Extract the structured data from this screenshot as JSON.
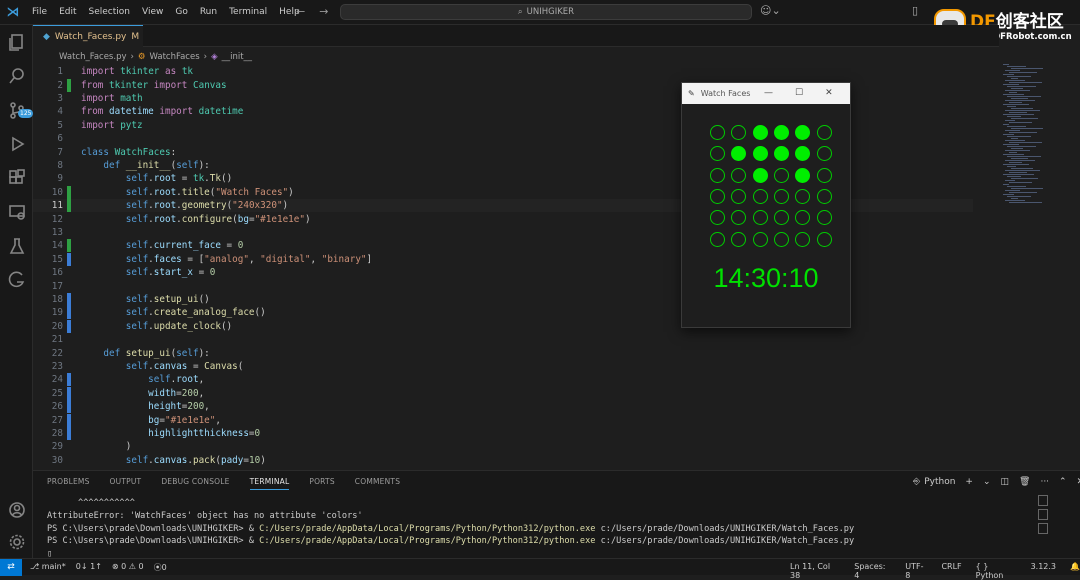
{
  "menu": [
    "File",
    "Edit",
    "Selection",
    "View",
    "Go",
    "Run",
    "Terminal",
    "Help"
  ],
  "search": {
    "text": "UNIHGIKER"
  },
  "watermark": {
    "brand": "DF",
    "name": "创客社区",
    "url": "mc.DFRobot.com.cn"
  },
  "activity": {
    "badge": "125"
  },
  "tab": {
    "filename": "Watch_Faces.py",
    "status": "M"
  },
  "breadcrumb": {
    "file": "Watch_Faces.py",
    "class": "WatchFaces",
    "method": "__init__"
  },
  "code_lines": [
    {
      "n": "1",
      "text": "import tkinter as tk"
    },
    {
      "n": "2",
      "text": "from tkinter import Canvas"
    },
    {
      "n": "3",
      "text": "import math"
    },
    {
      "n": "4",
      "text": "from datetime import datetime"
    },
    {
      "n": "5",
      "text": "import pytz"
    },
    {
      "n": "6",
      "text": ""
    },
    {
      "n": "7",
      "text": "class WatchFaces:"
    },
    {
      "n": "8",
      "text": "    def __init__(self):"
    },
    {
      "n": "9",
      "text": "        self.root = tk.Tk()"
    },
    {
      "n": "10",
      "text": "        self.root.title(\"Watch Faces\")"
    },
    {
      "n": "11",
      "text": "        self.root.geometry(\"240x320\")"
    },
    {
      "n": "12",
      "text": "        self.root.configure(bg=\"#1e1e1e\")"
    },
    {
      "n": "13",
      "text": ""
    },
    {
      "n": "14",
      "text": "        self.current_face = 0"
    },
    {
      "n": "15",
      "text": "        self.faces = [\"analog\", \"digital\", \"binary\"]"
    },
    {
      "n": "16",
      "text": "        self.start_x = 0"
    },
    {
      "n": "17",
      "text": ""
    },
    {
      "n": "18",
      "text": "        self.setup_ui()"
    },
    {
      "n": "19",
      "text": "        self.create_analog_face()"
    },
    {
      "n": "20",
      "text": "        self.update_clock()"
    },
    {
      "n": "21",
      "text": ""
    },
    {
      "n": "22",
      "text": "    def setup_ui(self):"
    },
    {
      "n": "23",
      "text": "        self.canvas = Canvas("
    },
    {
      "n": "24",
      "text": "            self.root,"
    },
    {
      "n": "25",
      "text": "            width=200,"
    },
    {
      "n": "26",
      "text": "            height=200,"
    },
    {
      "n": "27",
      "text": "            bg=\"#1e1e1e\","
    },
    {
      "n": "28",
      "text": "            highlightthickness=0"
    },
    {
      "n": "29",
      "text": "        )"
    },
    {
      "n": "30",
      "text": "        self.canvas.pack(pady=10)"
    }
  ],
  "panel": {
    "tabs": [
      "PROBLEMS",
      "OUTPUT",
      "DEBUG CONSOLE",
      "TERMINAL",
      "PORTS",
      "COMMENTS"
    ],
    "active_tab": "TERMINAL",
    "shell": "Python"
  },
  "terminal": {
    "caret": "      ^^^^^^^^^^^",
    "error": "AttributeError: 'WatchFaces' object has no attribute 'colors'",
    "prompt": "PS C:\\Users\\prade\\Downloads\\UNIHGIKER> & ",
    "exe": "C:/Users/prade/AppData/Local/Programs/Python/Python312/python.exe",
    "script": " c:/Users/prade/Downloads/UNIHGIKER/Watch_Faces.py",
    "cursor": "▯"
  },
  "status": {
    "branch": "main*",
    "sync": "0↓ 1↑",
    "errors": "⊗ 0 ⚠ 0",
    "ports": "⦿0",
    "position": "Ln 11, Col 38",
    "spaces": "Spaces: 4",
    "encoding": "UTF-8",
    "eol": "CRLF",
    "language": "Python",
    "version": "3.12.3"
  },
  "tk_window": {
    "title": "Watch Faces",
    "time": "14:30:10",
    "binary_grid": [
      [
        0,
        0,
        1,
        1,
        1,
        0
      ],
      [
        0,
        1,
        1,
        1,
        1,
        0
      ],
      [
        0,
        0,
        1,
        0,
        1,
        0
      ],
      [
        0,
        0,
        0,
        0,
        0,
        0
      ],
      [
        0,
        0,
        0,
        0,
        0,
        0
      ],
      [
        0,
        0,
        0,
        0,
        0,
        0
      ]
    ],
    "colors": {
      "bg": "#1e1e1e",
      "led": "#00ee00"
    }
  }
}
